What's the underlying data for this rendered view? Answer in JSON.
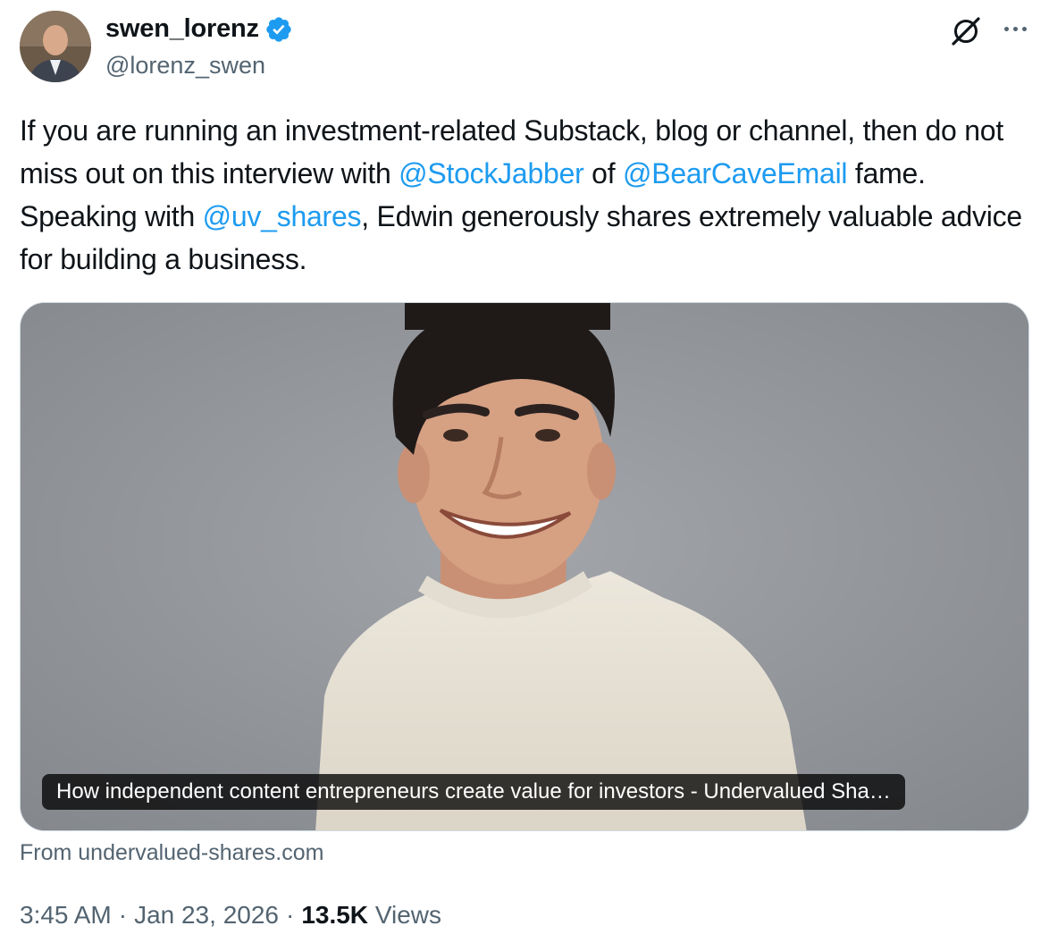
{
  "author": {
    "display_name": "swen_lorenz",
    "handle": "@lorenz_swen",
    "verified": true,
    "avatar": "profile-photo"
  },
  "icons": {
    "verified": "verified-badge-icon",
    "grok": "grok-icon",
    "more": "more-options-icon"
  },
  "colors": {
    "accent": "#1d9bf0",
    "text": "#0f1419",
    "secondary": "#536471",
    "border": "#cfd9de"
  },
  "tweet": {
    "segments": [
      {
        "text": "If you are running an investment-related Substack, blog or channel, then do not miss out on this interview with ",
        "type": "text"
      },
      {
        "text": "@StockJabber",
        "type": "mention"
      },
      {
        "text": " of ",
        "type": "text"
      },
      {
        "text": "@BearCaveEmail",
        "type": "mention"
      },
      {
        "text": " fame. Speaking with ",
        "type": "text"
      },
      {
        "text": "@uv_shares",
        "type": "mention"
      },
      {
        "text": ", Edwin generously shares extremely valuable advice for building a business.",
        "type": "text"
      }
    ]
  },
  "card": {
    "title": "How independent content entrepreneurs create value for investors - Undervalued Sha…",
    "source": "From undervalued-shares.com",
    "image": "portrait-photo"
  },
  "meta": {
    "time": "3:45 AM",
    "separator": "·",
    "date": "Jan 23, 2026",
    "views_count": "13.5K",
    "views_label": "Views"
  }
}
